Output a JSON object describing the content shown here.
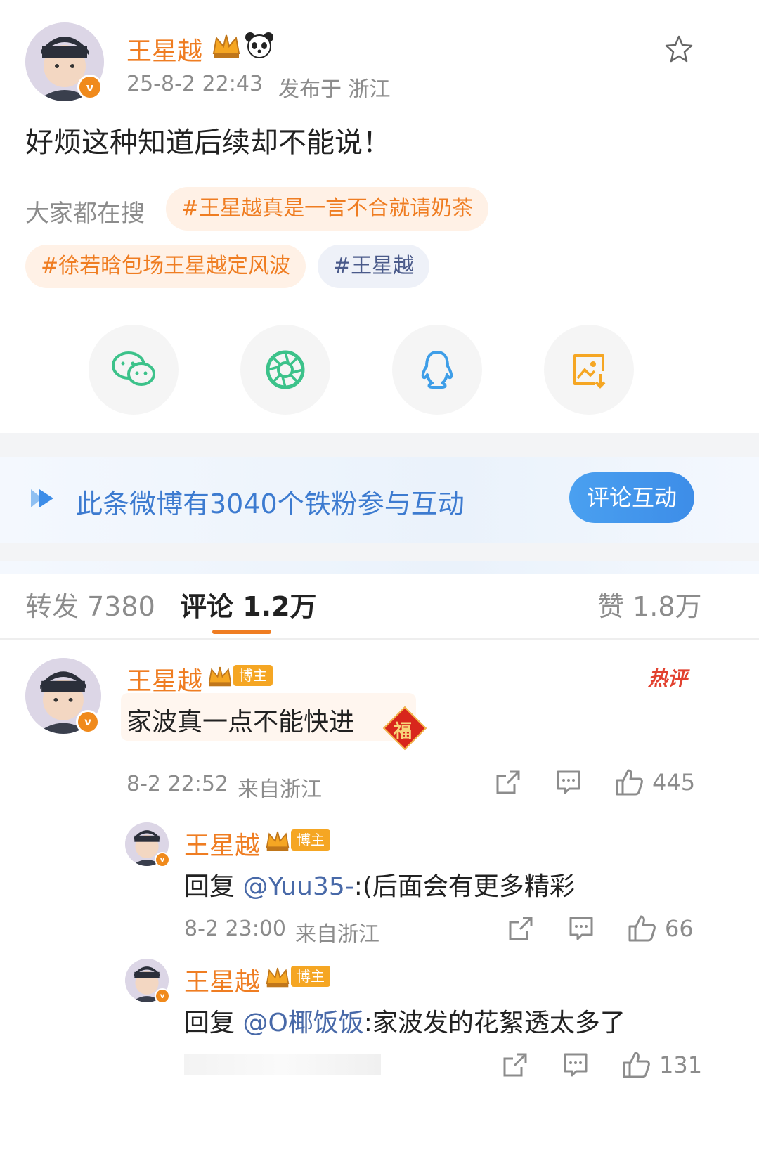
{
  "post": {
    "author": "王星越",
    "time": "25-8-2 22:43",
    "location": "发布于 浙江",
    "text": "好烦这种知道后续却不能说！",
    "search_label": "大家都在搜",
    "tags": [
      "#王星越真是一言不合就请奶茶",
      "#徐若晗包场王星越定风波",
      "#王星越"
    ]
  },
  "share_icons": [
    "wechat-icon",
    "moments-icon",
    "qq-icon",
    "save-image-icon"
  ],
  "fans": {
    "text": "此条微博有3040个铁粉参与互动",
    "button": "评论互动"
  },
  "tabs": {
    "repost": "转发 7380",
    "comment": "评论 1.2万",
    "like": "赞 1.8万"
  },
  "comments": [
    {
      "author": "王星越",
      "badge": "博主",
      "hot_label": "热评",
      "text": "家波真一点不能快进",
      "sticker": "福",
      "time": "8-2 22:52",
      "location": "来自浙江",
      "likes": "445",
      "replies": [
        {
          "author": "王星越",
          "badge": "博主",
          "reply_prefix": "回复 ",
          "mention": "@Yuu35-",
          "text": ":(后面会有更多精彩",
          "time": "8-2 23:00",
          "location": "来自浙江",
          "likes": "66"
        },
        {
          "author": "王星越",
          "badge": "博主",
          "reply_prefix": "回复 ",
          "mention": "@O椰饭饭",
          "text": ":家波发的花絮透太多了",
          "likes": "131"
        }
      ]
    }
  ],
  "colors": {
    "accent": "#ef7d22",
    "link": "#4869a8",
    "button": "#3d8de8"
  }
}
